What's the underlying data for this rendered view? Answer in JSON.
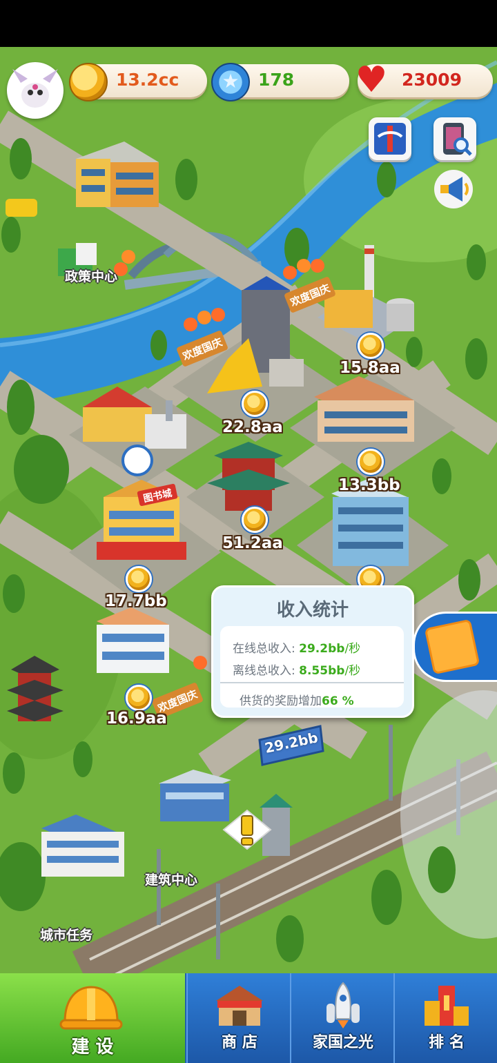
{
  "hud": {
    "coins": "13.2cc",
    "stars": "178",
    "hearts": "23009"
  },
  "buildings": [
    {
      "label": "政策中心"
    },
    {
      "label": "建筑中心"
    },
    {
      "label": "城市任务"
    }
  ],
  "incomes": [
    {
      "value": "15.8aa"
    },
    {
      "value": "22.8aa"
    },
    {
      "value": "13.3bb"
    },
    {
      "value": "51.2aa"
    },
    {
      "value": "17.7bb"
    },
    {
      "value": "16.9aa"
    }
  ],
  "billboard": "29.2bb",
  "banner_text": "欢度国庆",
  "library_sign": "图书城",
  "income_stats": {
    "title": "收入统计",
    "online_label": "在线总收入:",
    "online_value": "29.2bb",
    "online_unit": "/秒",
    "offline_label": "离线总收入:",
    "offline_value": "8.55bb",
    "offline_unit": "/秒",
    "bonus_label": "供货的奖励增加",
    "bonus_value": "66 %"
  },
  "nav": {
    "build": "建 设",
    "shop": "商 店",
    "homeland": "家国之光",
    "rank": "排 名"
  },
  "colors": {
    "grass": "#6fae3a",
    "river": "#2f8fd8",
    "road": "#b9b3a4",
    "nav_active": "#5cc22f",
    "nav_bg": "#1f5fae"
  }
}
